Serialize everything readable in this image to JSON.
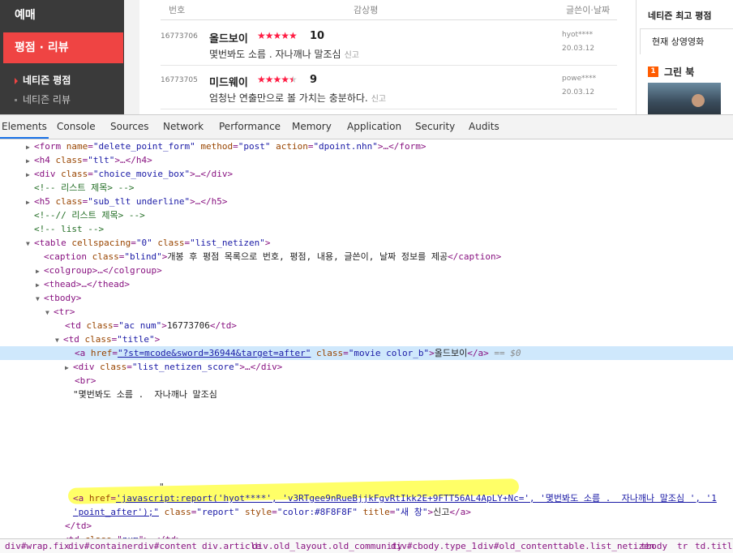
{
  "webpage": {
    "lnb": {
      "top_item": "예매",
      "active_item": "평점 · 리뷰",
      "sub_items": [
        "네티즌 평점",
        "네티즌 리뷰"
      ]
    },
    "table_header": {
      "num": "번호",
      "review": "감상평",
      "writer_date": "글쓴이·날짜"
    },
    "reviews": [
      {
        "num": "16773706",
        "title": "올드보이",
        "stars": "★★★★★",
        "score": "10",
        "text": "몇번봐도 소름 . 자나깨나 말조심",
        "report": "신고",
        "writer": "hyot****",
        "date": "20.03.12"
      },
      {
        "num": "16773705",
        "title": "미드웨이",
        "stars": "★★★★★",
        "score": "9",
        "text": "엄청난 연출만으로 볼 가치는 충분하다.",
        "report": "신고",
        "writer": "powe****",
        "date": "20.03.12"
      }
    ],
    "aside": {
      "title": "네티즌 최고 평점",
      "tab": "현재 상영영화",
      "rank": "1",
      "movie": "그린 북"
    }
  },
  "devtools": {
    "tabs": [
      "Elements",
      "Console",
      "Sources",
      "Network",
      "Performance",
      "Memory",
      "Application",
      "Security",
      "Audits"
    ],
    "active_tab": "Elements",
    "lines": {
      "l1": "\"delete_point_form\"",
      "l1b": "\"post\"",
      "l1c": "\"dpoint.nhn\"",
      "l2": "\"tlt\"",
      "l3": "\"choice_movie_box\"",
      "l4": "<!-- 리스트 제목> -->",
      "l5": "\"sub_tlt underline\"",
      "l6": "<!--// 리스트 제목> -->",
      "l7": "<!-- list -->",
      "l8a": "\"0\"",
      "l8b": "\"list_netizen\"",
      "l9": "\"blind\"",
      "l9t": "개봉 후 평점 목록으로 번호, 평점, 내용, 글쓴이, 날짜 정보를 제공",
      "l13": "\"ac num\"",
      "l13t": "16773706",
      "l14": "\"title\"",
      "l15href": "\"?st=mcode&sword=36944&target=after\"",
      "l15cls": "\"movie color_b\"",
      "l15t": "올드보이",
      "l15eq": " == $0",
      "l16": "\"list_netizen_score\"",
      "l18": "\"몇번봐도 소름 .  자나깨나 말조심",
      "l19": "\"",
      "l20href": "'javascript:report('hyot****', 'v3RTgee9nRueBjjkFgvRtIkk2E+9FTT56AL4ApLY+Nc=', '몇번봐도 소름 .  자나깨나 말조심 ', '1",
      "l21a": "'point_after');\"",
      "l21cls": "\"report\"",
      "l21sty": "\"color:#8F8F8F\"",
      "l21tit": "\"새 창\"",
      "l21t": "신고"
    },
    "breadcrumb": [
      "div#wrap.fix",
      "div#container",
      "div#content",
      "div.article",
      "div.old_layout.old_community",
      "div#cbody.type_1",
      "div#old_content",
      "table.list_netizen",
      "tbody",
      "tr",
      "td.title"
    ]
  }
}
